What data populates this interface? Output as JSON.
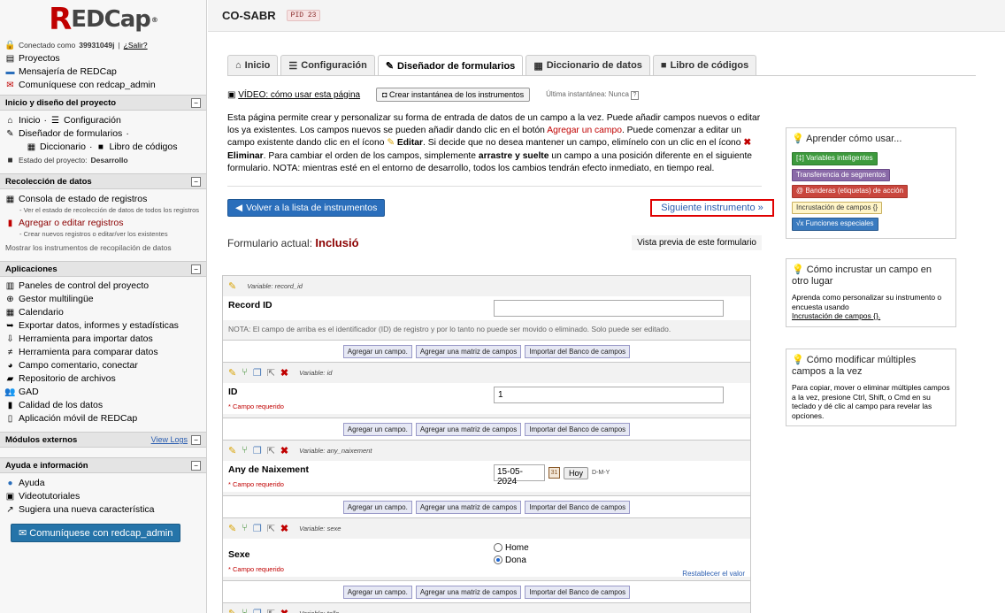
{
  "sidebar": {
    "logo": "REDCap",
    "connected_prefix": "Conectado como",
    "username": "39931049j",
    "logout": "¿Salir?",
    "links_top": [
      "Proyectos",
      "Mensajería de REDCap",
      "Comuníquese con redcap_admin"
    ],
    "section_project": "Inicio y diseño del proyecto",
    "home": "Inicio",
    "config": "Configuración",
    "designer": "Diseñador de formularios",
    "dictionary": "Diccionario",
    "codebook": "Libro de códigos",
    "status_label": "Estado del proyecto:",
    "status_value": "Desarrollo",
    "section_data": "Recolección de datos",
    "record_status": "Consola de estado de registros",
    "record_status_sub": "- Ver el estado de recolección de datos de todos los registros",
    "add_edit": "Agregar o editar registros",
    "add_edit_sub": "- Crear nuevos registros o editar/ver los existentes",
    "show_instruments": "Mostrar los instrumentos de recopilación de datos",
    "section_apps": "Aplicaciones",
    "apps": [
      "Paneles de control del proyecto",
      "Gestor multilingüe",
      "Calendario",
      "Exportar datos, informes y estadísticas",
      "Herramienta para importar datos",
      "Herramienta para comparar datos",
      "Campo comentario, conectar",
      "Repositorio de archivos",
      "GAD",
      "Calidad de los datos",
      "Aplicación móvil de REDCap"
    ],
    "section_modules": "Módulos externos",
    "view_logs": "View Logs",
    "section_help": "Ayuda e información",
    "help_links": [
      "Ayuda",
      "Videotutoriales",
      "Sugiera una nueva característica"
    ],
    "admin_button": "Comuníquese con redcap_admin"
  },
  "header": {
    "project": "CO-SABR",
    "pid": "PID 23"
  },
  "tabs": [
    "Inicio",
    "Configuración",
    "Diseñador de formularios",
    "Diccionario de datos",
    "Libro de códigos"
  ],
  "toolbar": {
    "video": "VÍDEO: cómo usar esta página",
    "snapshot": "Crear instantánea de los instrumentos",
    "last_snapshot": "Última instantánea: Nunca",
    "help_q": "?"
  },
  "intro": {
    "p1": "Esta página permite crear y personalizar su forma de entrada de datos de un campo a la vez. Puede añadir campos nuevos o editar los ya existentes. Los campos nuevos se pueden añadir dando clic en el botón",
    "add_field_link": "Agregar un campo",
    "p2": ". Puede comenzar a editar un campo existente dando clic en el ícono",
    "edit_word": "Editar",
    "p3": ". Si decide que no desea mantener un campo, elimínelo con un clic en el ícono",
    "delete_word": "Eliminar",
    "p4": ". Para cambiar el orden de los campos, simplemente",
    "drag_word": "arrastre y suelte",
    "p5": "un campo a una posición diferente en el siguiente formulario. NOTA: mientras esté en el entorno de desarrollo, todos los cambios tendrán efecto inmediato, en tiempo real."
  },
  "nav": {
    "back": "Volver a la lista de instrumentos",
    "next": "Siguiente instrumento"
  },
  "form": {
    "current_label": "Formulario actual:",
    "current_name": "Inclusió",
    "preview": "Vista previa de este formulario",
    "variable_prefix": "Variable:",
    "required": "* Campo requerido",
    "record_note": "NOTA: El campo de arriba es el identificador (ID) de registro y por lo tanto no puede ser movido o eliminado. Solo puede ser editado.",
    "add_buttons": [
      "Agregar un campo.",
      "Agregar una matriz de campos",
      "Importar del Banco de campos"
    ],
    "fields": [
      {
        "var": "record_id",
        "label": "Record ID",
        "value": ""
      },
      {
        "var": "id",
        "label": "ID",
        "value": "1"
      },
      {
        "var": "any_naixement",
        "label": "Any de Naixement",
        "value": "15-05-2024",
        "today": "Hoy",
        "format": "D-M-Y"
      },
      {
        "var": "sexe",
        "label": "Sexe",
        "options": [
          "Home",
          "Dona"
        ],
        "reset": "Restablecer el valor"
      },
      {
        "var": "talla"
      }
    ]
  },
  "panels": {
    "learn_title": "Aprender cómo usar...",
    "badges": [
      "[‡] Variables inteligentes",
      "Transferencia de segmentos",
      "@ Banderas (etiquetas) de acción",
      "Incrustación de campos {}",
      "√x Funciones especiales"
    ],
    "embed_title": "Cómo incrustar un campo en otro lugar",
    "embed_text": "Aprenda como personalizar su instrumento o encuesta usando",
    "embed_link": "Incrustación de campos {}.",
    "multi_title": "Cómo modificar múltiples campos a la vez",
    "multi_text": "Para copiar, mover o eliminar múltiples campos a la vez, presione Ctrl, Shift, o Cmd en su teclado y dé clic al campo para revelar las opciones."
  }
}
